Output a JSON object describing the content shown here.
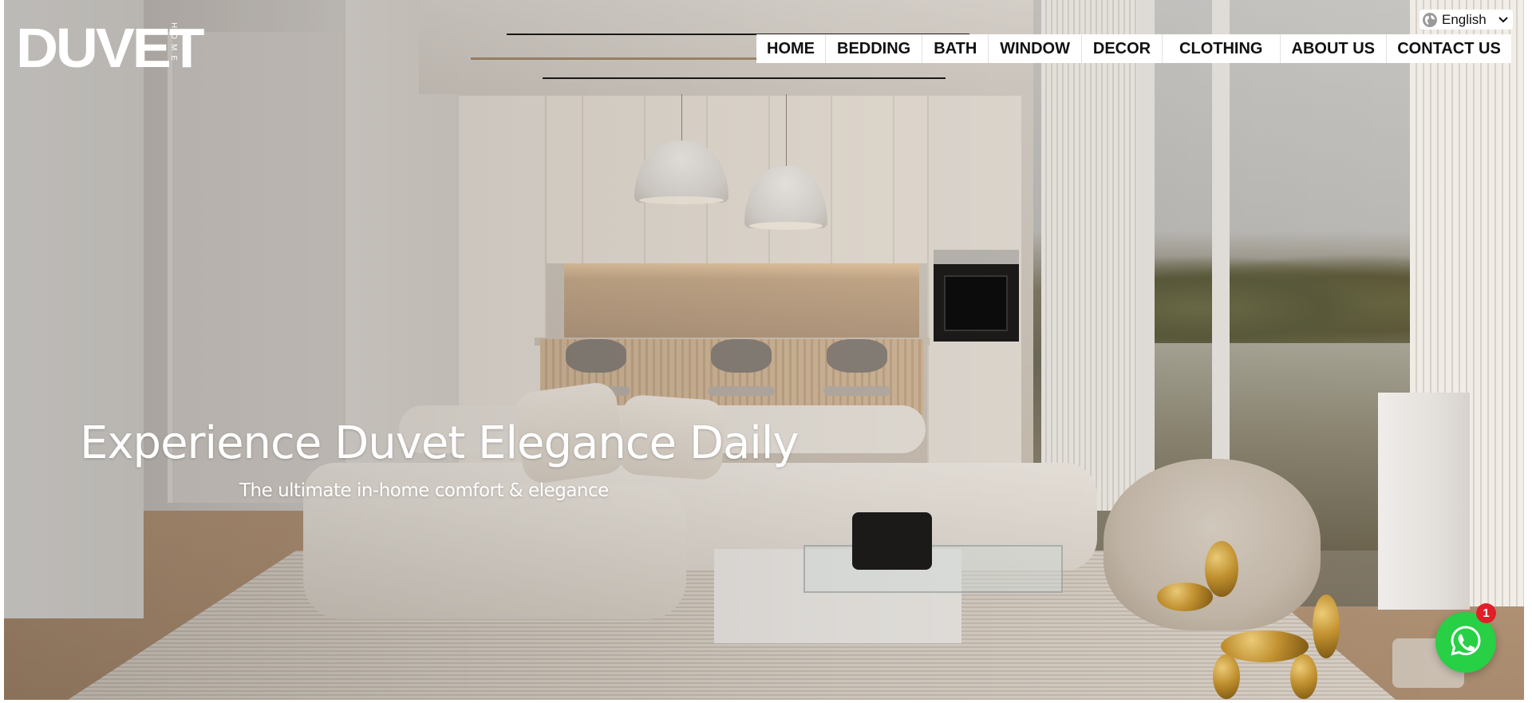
{
  "logo": {
    "word": "DUVET",
    "sub": "HOME"
  },
  "language_selector": {
    "selected": "English",
    "icon": "globe-icon",
    "chevron_icon": "chevron-down-icon"
  },
  "nav": {
    "items": [
      {
        "label": "HOME"
      },
      {
        "label": "BEDDING"
      },
      {
        "label": "BATH"
      },
      {
        "label": "WINDOW"
      },
      {
        "label": "DECOR"
      },
      {
        "label": "CLOTHING"
      },
      {
        "label": "ABOUT US"
      },
      {
        "label": "CONTACT US"
      }
    ]
  },
  "hero": {
    "title": "Experience Duvet Elegance Daily",
    "subtitle": "The ultimate in-home comfort & elegance"
  },
  "whatsapp": {
    "icon": "whatsapp-icon",
    "badge_count": "1",
    "button_color": "#27d045",
    "badge_color": "#e02029"
  }
}
